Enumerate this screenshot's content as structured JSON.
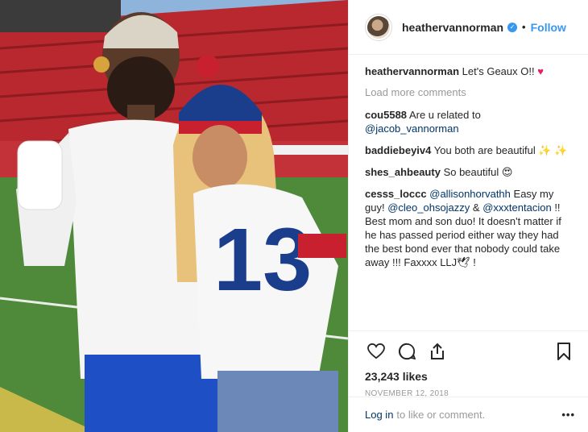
{
  "post": {
    "username": "heathervannorman",
    "follow_label": "Follow",
    "separator": "•",
    "caption": {
      "user": "heathervannorman",
      "text": "Let's Geaux O!!",
      "emoji": "♥"
    },
    "load_more": "Load more comments",
    "comments": [
      {
        "user": "cou5588",
        "text": "Are u related to",
        "mention": "@jacob_vannorman"
      },
      {
        "user": "baddiebeyiv4",
        "text": "You both are beautiful",
        "emoji": "✨ ✨"
      },
      {
        "user": "shes_ahbeauty",
        "text": "So beautiful",
        "emoji": "😍"
      },
      {
        "user": "cesss_loccc",
        "mention1": "@allisonhorvathh",
        "text1": "Easy my guy!",
        "mention2": "@cleo_ohsojazzy",
        "amp": "&",
        "mention3": "@xxxtentacion",
        "text2": "!! Best mom and son duo! It doesn't matter if he has passed period either way they had the best bond ever that nobody could take away !!! Faxxxx LLJ",
        "emoji": "🕊",
        "text3": "!"
      }
    ],
    "likes": "23,243 likes",
    "date": "NOVEMBER 12, 2018",
    "footer": {
      "login": "Log in",
      "text": "to like or comment.",
      "more": "•••"
    },
    "colors": {
      "accent": "#3897f0",
      "mention": "#003569",
      "muted": "#999999"
    },
    "icons": [
      "heart-icon",
      "comment-icon",
      "share-icon",
      "bookmark-icon"
    ]
  }
}
